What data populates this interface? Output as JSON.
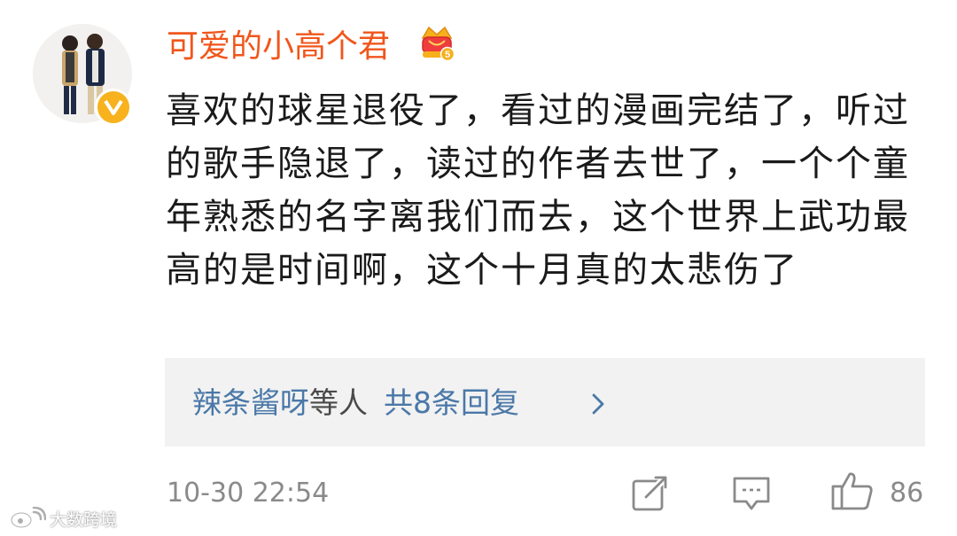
{
  "comment": {
    "username": "可爱的小高个君",
    "vip_level": "5",
    "verified_badge": "V",
    "text": "喜欢的球星退役了，看过的漫画完结了，听过的歌手隐退了，读过的作者去世了，一个个童年熟悉的名字离我们而去，这个世界上武功最高的是时间啊，这个十月真的太悲伤了",
    "replies": {
      "names": "辣条酱呀",
      "others": "等人",
      "count_label": "共8条回复"
    },
    "timestamp": "10-30 22:54",
    "like_count": "86"
  },
  "watermark": {
    "text": "大数跨境"
  },
  "icons": {
    "avatar": "avatar",
    "verified": "verified-badge-icon",
    "vip": "crown-vip-icon",
    "chevron": "chevron-right-icon",
    "share": "share-icon",
    "comment": "comment-icon",
    "like": "thumbs-up-icon"
  },
  "colors": {
    "username": "#f0561b",
    "reply_link": "#4a78a8",
    "meta_text": "#8a8a8a",
    "reply_box_bg": "#f2f2f2",
    "badge": "#f7b21e"
  }
}
